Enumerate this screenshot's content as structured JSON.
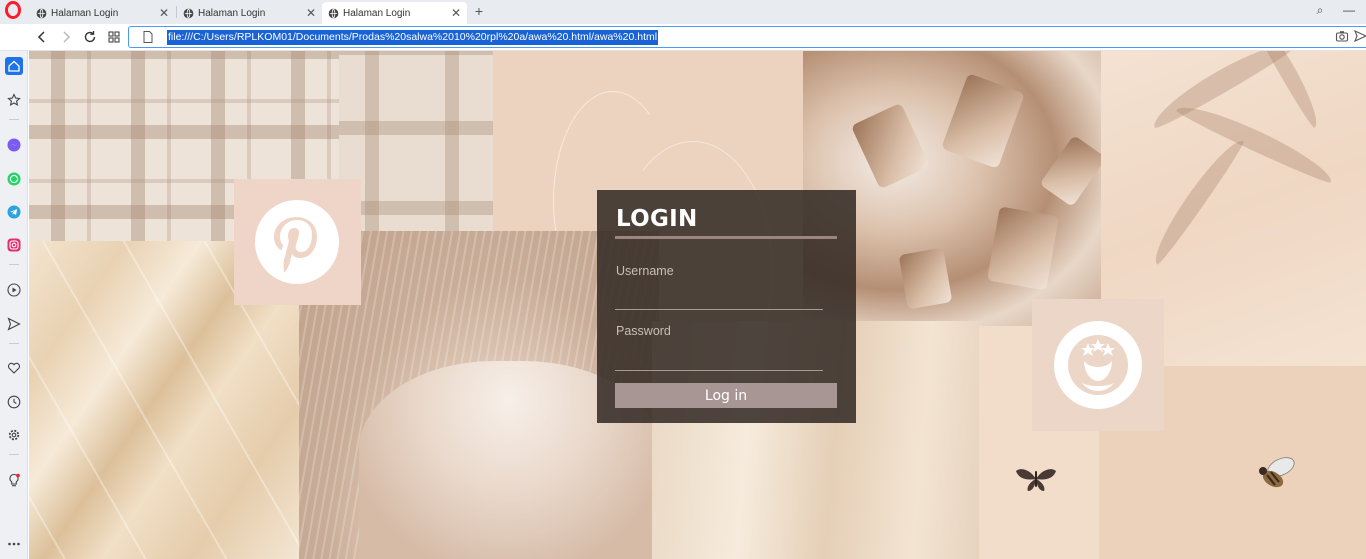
{
  "tabs": [
    {
      "label": "Halaman Login",
      "close": "✕"
    },
    {
      "label": "Halaman Login",
      "close": "✕"
    },
    {
      "label": "Halaman Login",
      "close": "✕"
    }
  ],
  "new_tab": "+",
  "window": {
    "search": "⌕",
    "minimize": "—"
  },
  "address": {
    "url": "file:///C:/Users/RPLKOM01/Documents/Prodas%20salwa%2010%20rpl%20a/awa%20.html/awa%20.html"
  },
  "sidebar_icons": [
    "home-icon",
    "star-icon",
    "messenger-icon",
    "whatsapp-icon",
    "telegram-icon",
    "instagram-icon",
    "player-icon",
    "send-icon",
    "heart-icon",
    "history-icon",
    "settings-icon",
    "bulb-icon",
    "more-icon"
  ],
  "login": {
    "title": "LOGIN",
    "username_label": "Username",
    "username_value": "",
    "password_label": "Password",
    "password_value": "",
    "button_label": "Log in"
  },
  "colors": {
    "accent": "#1a63d7",
    "form_bg": "#362c27",
    "button_bg": "#a79693",
    "opera_red": "#ff1b2d"
  }
}
